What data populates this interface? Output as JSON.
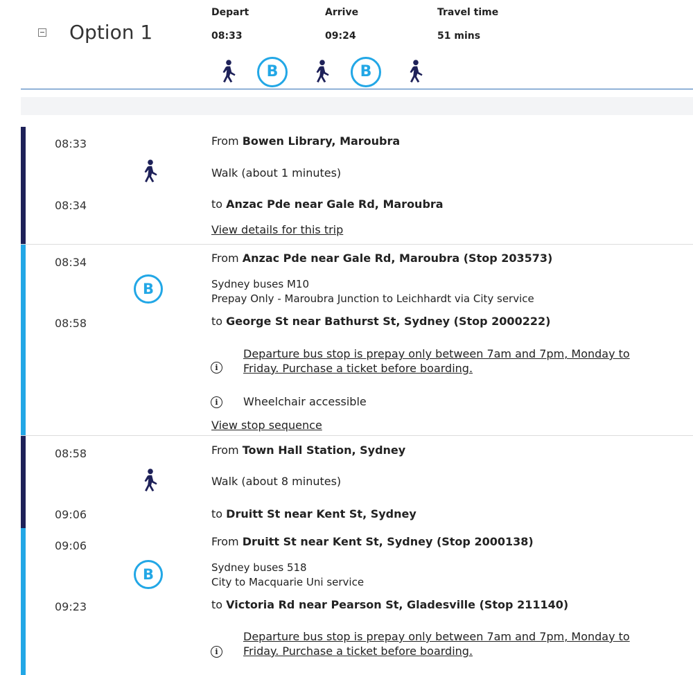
{
  "header": {
    "option_title": "Option 1",
    "depart_label": "Depart",
    "arrive_label": "Arrive",
    "travel_label": "Travel time",
    "depart_time": "08:33",
    "arrive_time": "09:24",
    "travel_time": "51 mins",
    "mode_icons": [
      "walk-icon",
      "bus-icon",
      "walk-icon",
      "bus-icon",
      "walk-icon"
    ],
    "bus_letter": "B"
  },
  "colors": {
    "walk_bar": "#1e2159",
    "bus_bar": "#22a7e6",
    "bus_icon": "#22a7e6",
    "divider": "#2f6db4"
  },
  "legs": [
    {
      "mode": "walk",
      "start_time": "08:33",
      "end_time": "08:34",
      "from_prefix": "From",
      "from_place": "Bowen Library, Maroubra",
      "detail": "Walk (about 1 minutes)",
      "to_prefix": "to",
      "to_place": "Anzac Pde near Gale Rd, Maroubra",
      "link": "View details for this trip"
    },
    {
      "mode": "bus",
      "start_time": "08:34",
      "end_time": "08:58",
      "from_prefix": "From",
      "from_place": "Anzac Pde near Gale Rd, Maroubra (Stop 203573)",
      "service": "Sydney buses M10",
      "service_desc": "Prepay Only - Maroubra Junction to Leichhardt via City service",
      "to_prefix": "to",
      "to_place": "George St near Bathurst St, Sydney (Stop 2000222)",
      "notice_line1": "Departure bus stop is prepay only between 7am and 7pm, Monday to",
      "notice_line2": "Friday. Purchase a ticket before boarding.",
      "accessible": "Wheelchair accessible",
      "link": "View stop sequence"
    },
    {
      "mode": "walk",
      "start_time": "08:58",
      "end_time": "09:06",
      "from_prefix": "From",
      "from_place": "Town Hall Station, Sydney",
      "detail": "Walk (about 8 minutes)",
      "to_prefix": "to",
      "to_place": "Druitt St near Kent St, Sydney"
    },
    {
      "mode": "bus",
      "start_time": "09:06",
      "end_time": "09:23",
      "from_prefix": "From",
      "from_place": "Druitt St near Kent St, Sydney (Stop 2000138)",
      "service": "Sydney buses 518",
      "service_desc": "City to Macquarie Uni service",
      "to_prefix": "to",
      "to_place": "Victoria Rd near Pearson St, Gladesville (Stop 211140)",
      "notice_line1": "Departure bus stop is prepay only between 7am and 7pm, Monday to",
      "notice_line2": "Friday. Purchase a ticket before boarding."
    }
  ],
  "info_glyph": "i"
}
